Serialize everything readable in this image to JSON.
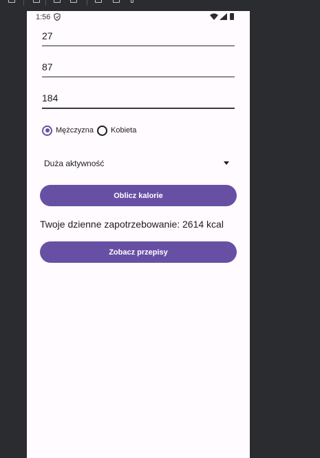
{
  "status_bar": {
    "time": "1:56"
  },
  "inputs": [
    {
      "name": "age",
      "value": "27"
    },
    {
      "name": "weight",
      "value": "87"
    },
    {
      "name": "height",
      "value": "184"
    }
  ],
  "gender": {
    "options": [
      {
        "label": "Mężczyzna",
        "checked": true
      },
      {
        "label": "Kobieta",
        "checked": false
      }
    ]
  },
  "activity": {
    "selected": "Duża aktywność"
  },
  "buttons": {
    "calculate": "Oblicz kalorie",
    "recipes": "Zobacz przepisy"
  },
  "result": {
    "text": "Twoje dzienne zapotrzebowanie: 2614 kcal"
  },
  "colors": {
    "accent": "#6750a4",
    "background": "#fffbfe",
    "frame": "#2b2c30"
  }
}
